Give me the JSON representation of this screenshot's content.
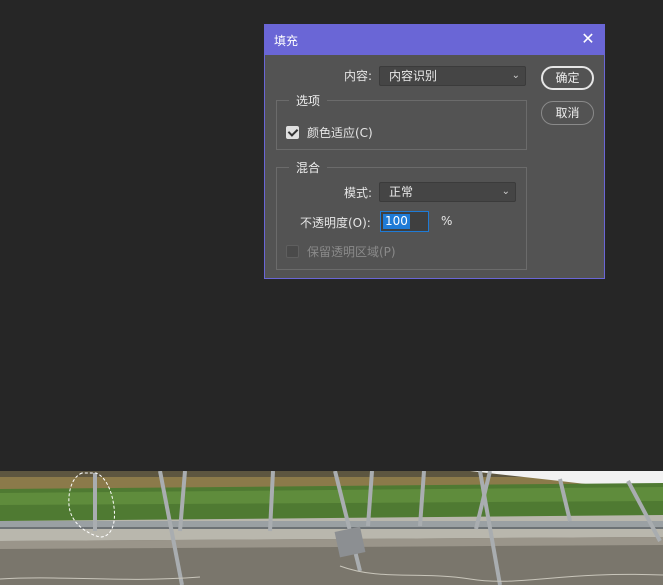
{
  "dialog": {
    "title": "填充",
    "close_label": "✕",
    "content": {
      "label": "内容:",
      "value": "内容识别"
    },
    "buttons": {
      "ok": "确定",
      "cancel": "取消"
    },
    "options": {
      "legend": "选项",
      "color_adaptation": {
        "label": "颜色适应(C)",
        "checked": true
      }
    },
    "blending": {
      "legend": "混合",
      "mode": {
        "label": "模式:",
        "value": "正常"
      },
      "opacity": {
        "label": "不透明度(O):",
        "value": "100",
        "unit": "%"
      },
      "preserve_transparency": {
        "label": "保留透明区域(P)",
        "checked": false,
        "enabled": false
      }
    }
  },
  "colors": {
    "titlebar": "#6a66d6",
    "dialog_bg": "#535353",
    "workspace_bg": "#262626",
    "selection_highlight": "#1f7bd6"
  },
  "icons": {
    "close": "close-icon",
    "dropdown": "chevron-down-icon"
  }
}
